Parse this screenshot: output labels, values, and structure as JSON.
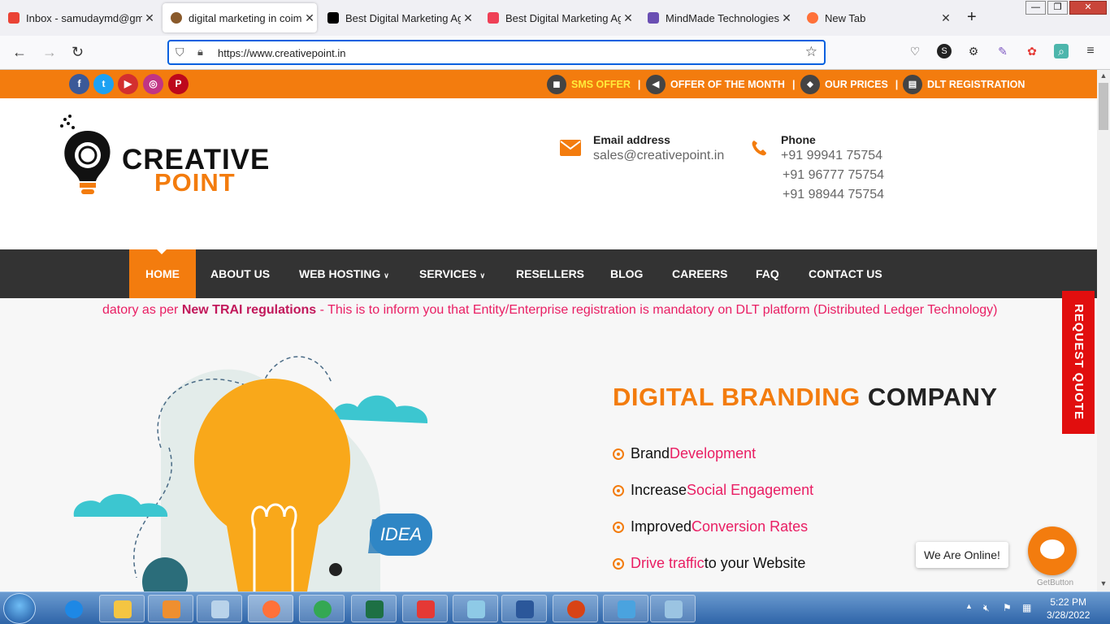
{
  "browser": {
    "tabs": [
      {
        "label": "Inbox - samudaymd@gma",
        "close": "✕"
      },
      {
        "label": "digital marketing in coimb",
        "close": "✕"
      },
      {
        "label": "Best Digital Marketing Age",
        "close": "✕"
      },
      {
        "label": "Best Digital Marketing Age",
        "close": "✕"
      },
      {
        "label": "MindMade Technologies -",
        "close": "✕"
      },
      {
        "label": "New Tab",
        "close": "✕"
      }
    ],
    "new_tab": "+",
    "url": "https://www.creativepoint.in",
    "window_controls": [
      "—",
      "❐",
      "✕"
    ]
  },
  "site": {
    "social": [
      "f",
      "t",
      "▶",
      "◎",
      "P"
    ],
    "top_links": [
      {
        "label": "SMS OFFER",
        "color": "#ffeb3b",
        "sep": "|"
      },
      {
        "label": "OFFER OF THE MONTH",
        "color": "#ffffff",
        "sep": "|"
      },
      {
        "label": "OUR PRICES",
        "color": "#ffffff",
        "sep": "|"
      },
      {
        "label": "DLT REGISTRATION",
        "color": "#ffffff",
        "sep": ""
      }
    ],
    "logo": {
      "line1": "CREATIVE",
      "line2": "POINT"
    },
    "email": {
      "label": "Email address",
      "value": "sales@creativepoint.in"
    },
    "phone": {
      "label": "Phone",
      "numbers": [
        "+91 99941 75754",
        "+91 96777 75754",
        "+91 98944 75754"
      ]
    },
    "nav": [
      "HOME",
      "ABOUT US",
      "WEB HOSTING",
      "SERVICES",
      "RESELLERS",
      "BLOG",
      "CAREERS",
      "FAQ",
      "CONTACT US"
    ],
    "marquee": {
      "prefix": "datory as per ",
      "bold": "New TRAI regulations",
      "rest": " - This is to inform you that Entity/Enterprise registration is mandatory on DLT platform (Distributed Ledger Technology)"
    },
    "hero": {
      "title_orange": "DIGITAL BRANDING",
      "title_dark": " COMPANY"
    },
    "features": [
      {
        "plain": "Brand ",
        "highlight": "Development",
        "tail": ""
      },
      {
        "plain": "Increase ",
        "highlight": "Social Engagement",
        "tail": ""
      },
      {
        "plain": "Improved ",
        "highlight": "Conversion Rates",
        "tail": ""
      },
      {
        "plain": "",
        "highlight": "Drive traffic",
        "tail": " to your Website"
      }
    ],
    "idea_bubble": "IDEA",
    "request_quote": "REQUEST QUOTE",
    "chat": {
      "online": "We Are Online!",
      "getbutton": "GetButton"
    },
    "colors": {
      "orange": "#f37c0e",
      "pink": "#e91e63",
      "nav_bg": "#333333",
      "quote_red": "#e10e0e"
    }
  },
  "taskbar": {
    "time": "5:22 PM",
    "date": "3/28/2022"
  }
}
